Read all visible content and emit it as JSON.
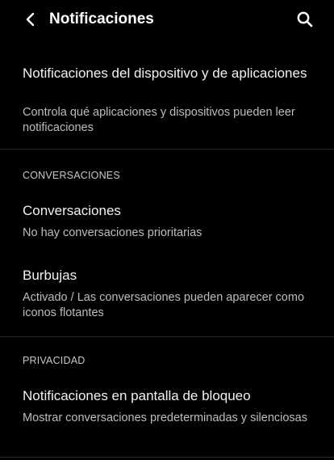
{
  "app_bar": {
    "title": "Notificaciones",
    "back_icon": "chevron-left-icon",
    "search_icon": "search-icon"
  },
  "items": [
    {
      "title": "Notificaciones del dispositivo y de aplicaciones",
      "summary": "Controla qué aplicaciones y dispositivos pueden leer notificaciones"
    },
    {
      "title": "Conversaciones",
      "summary": "No hay conversaciones prioritarias"
    },
    {
      "title": "Burbujas",
      "summary": "Activado / Las conversaciones pueden aparecer como iconos flotantes"
    },
    {
      "title": "Notificaciones en pantalla de bloqueo",
      "summary": "Mostrar conversaciones predeterminadas y silenciosas"
    }
  ],
  "sections": {
    "conversations_header": "CONVERSACIONES",
    "privacy_header": "PRIVACIDAD"
  },
  "colors": {
    "background": "#000000",
    "title_text": "#f2f2f2",
    "summary_text": "#bdbdbd",
    "divider": "#2a2a2a"
  }
}
